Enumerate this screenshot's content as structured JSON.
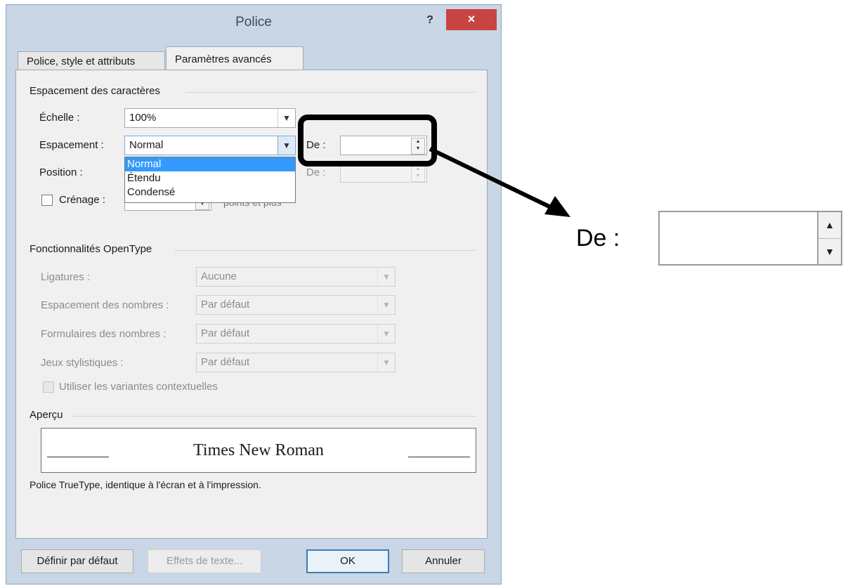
{
  "dialog": {
    "title": "Police",
    "help": "?",
    "close": "×"
  },
  "tabs": [
    {
      "label": "Police, style et attributs",
      "active": false
    },
    {
      "label": "Paramètres avancés",
      "active": true
    }
  ],
  "char_spacing": {
    "section_title": "Espacement des caractères",
    "scale_label": "Échelle :",
    "scale_value": "100%",
    "spacing_label": "Espacement :",
    "spacing_value": "Normal",
    "spacing_options": [
      "Normal",
      "Étendu",
      "Condensé"
    ],
    "spacing_selected": "Normal",
    "by_label_1": "De :",
    "by_value_1": "",
    "position_label": "Position :",
    "by_label_2": "De :",
    "by_value_2": "",
    "kerning_label": "Crénage :",
    "kerning_suffix": "points et plus"
  },
  "opentype": {
    "section_title": "Fonctionnalités OpenType",
    "ligatures_label": "Ligatures :",
    "ligatures_value": "Aucune",
    "num_spacing_label": "Espacement des nombres :",
    "num_spacing_value": "Par défaut",
    "num_forms_label": "Formulaires des nombres :",
    "num_forms_value": "Par défaut",
    "stylistic_label": "Jeux stylistiques :",
    "stylistic_value": "Par défaut",
    "contextual_label": "Utiliser les variantes contextuelles"
  },
  "preview": {
    "section_title": "Aperçu",
    "sample": "Times New Roman",
    "caption": "Police TrueType, identique à l'écran et à l'impression."
  },
  "buttons": {
    "set_default": "Définir par défaut",
    "text_effects": "Effets de texte...",
    "ok": "OK",
    "cancel": "Annuler"
  },
  "callout": {
    "label": "De :",
    "value": ""
  },
  "colors": {
    "close_button": "#c74443",
    "selection": "#3399ff",
    "dialog_frame": "#c9d6e6"
  }
}
